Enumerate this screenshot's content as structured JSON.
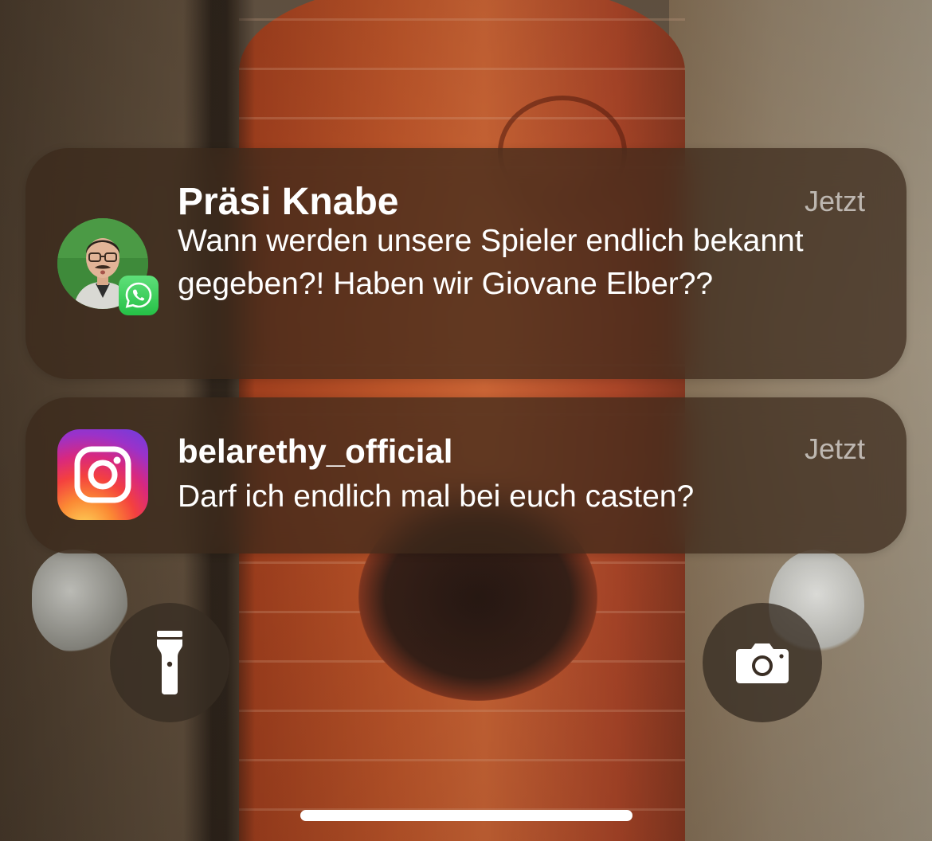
{
  "notifications": [
    {
      "app": "WhatsApp",
      "app_icon": "whatsapp-icon",
      "sender": "Präsi Knabe",
      "time": "Jetzt",
      "message": "Wann werden unsere Spieler endlich bekannt gegeben?! Haben wir Giovane Elber??"
    },
    {
      "app": "Instagram",
      "app_icon": "instagram-icon",
      "sender": "belarethy_official",
      "time": "Jetzt",
      "message": "Darf ich endlich mal bei euch casten?"
    }
  ],
  "quick_actions": {
    "left_icon": "flashlight-icon",
    "right_icon": "camera-icon"
  },
  "colors": {
    "notification_bg": "#3a281a",
    "whatsapp_green": "#25c046",
    "text_primary": "#ffffff",
    "text_secondary": "#b8aa98"
  }
}
